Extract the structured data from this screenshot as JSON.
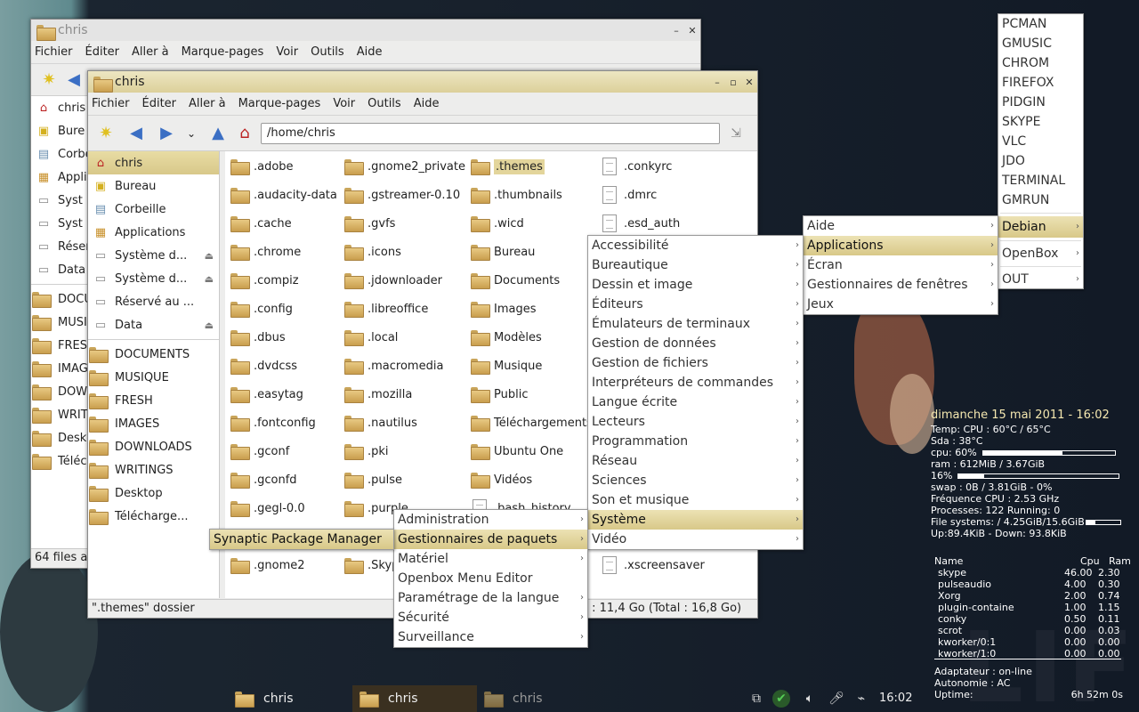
{
  "window_back": {
    "title": "chris",
    "menus": [
      "Fichier",
      "Éditer",
      "Aller à",
      "Marque-pages",
      "Voir",
      "Outils",
      "Aide"
    ],
    "sidebar": [
      "chris",
      "Bureau",
      "Corbeille",
      "Applications",
      "Système d...",
      "Système d...",
      "Réservé au ...",
      "Data",
      "DOCUMENTS",
      "MUSIQUE",
      "FRESH",
      "IMAGES",
      "DOWNLOADS",
      "WRITINGS",
      "Desktop",
      "Télécharge..."
    ],
    "sidebar_visible": [
      "chris",
      "Bure",
      "Corbe",
      "Applic",
      "Syst",
      "Syst",
      "Réser",
      "Data",
      "DOCU",
      "MUSI",
      "FRES",
      "IMAG",
      "DOW",
      "WRIT",
      "Desk",
      "Téléc"
    ],
    "status": "64 files and"
  },
  "window_front": {
    "title": "chris",
    "menus": [
      "Fichier",
      "Éditer",
      "Aller à",
      "Marque-pages",
      "Voir",
      "Outils",
      "Aide"
    ],
    "address": "/home/chris",
    "sidebar_places": [
      "chris",
      "Bureau",
      "Corbeille",
      "Applications",
      "Système d...",
      "Système d...",
      "Réservé au ...",
      "Data"
    ],
    "sidebar_bookmarks": [
      "DOCUMENTS",
      "MUSIQUE",
      "FRESH",
      "IMAGES",
      "DOWNLOADS",
      "WRITINGS",
      "Desktop",
      "Télécharge..."
    ],
    "col1": [
      ".adobe",
      ".audacity-data",
      ".cache",
      ".chrome",
      ".compiz",
      ".config",
      ".dbus",
      ".dvdcss",
      ".easytag",
      ".fontconfig",
      ".gconf",
      ".gconfd",
      ".gegl-0.0",
      "",
      ".gnome2"
    ],
    "col2": [
      ".gnome2_private",
      ".gstreamer-0.10",
      ".gvfs",
      ".icons",
      ".jdownloader",
      ".libreoffice",
      ".local",
      ".macromedia",
      ".mozilla",
      ".nautilus",
      ".pki",
      ".pulse",
      ".purple",
      "",
      ".Skyp"
    ],
    "col3": [
      ".themes",
      ".thumbnails",
      ".wicd",
      "Bureau",
      "Documents",
      "Images",
      "Modèles",
      "Musique",
      "Public",
      "Téléchargements",
      "Ubuntu One",
      "Vidéos",
      ".bash_history"
    ],
    "col4": [
      ".conkyrc",
      ".dmrc",
      ".esd_auth"
    ],
    "col4_last": ".xscreensaver",
    "status_left": "\".themes\" dossier",
    "status_right": "e : 11,4 Go (Total : 16,8 Go)"
  },
  "menu_root": {
    "apps": [
      "PCMAN",
      "GMUSIC",
      "CHROM",
      "FIREFOX",
      "PIDGIN",
      "SKYPE",
      "VLC",
      "JDO",
      "TERMINAL",
      "GMRUN"
    ],
    "debian": "Debian",
    "openbox": "OpenBox",
    "out": "OUT"
  },
  "menu_debian": [
    "Aide",
    "Applications",
    "Écran",
    "Gestionnaires de fenêtres",
    "Jeux"
  ],
  "menu_applications": [
    "Accessibilité",
    "Bureautique",
    "Dessin et image",
    "Éditeurs",
    "Émulateurs de terminaux",
    "Gestion de données",
    "Gestion de fichiers",
    "Interpréteurs de commandes",
    "Langue écrite",
    "Lecteurs",
    "Programmation",
    "Réseau",
    "Sciences",
    "Son et musique",
    "Système",
    "Vidéo"
  ],
  "menu_systeme": [
    "Administration",
    "Gestionnaires de paquets",
    "Matériel",
    "Openbox Menu Editor",
    "Paramétrage de la langue",
    "Sécurité",
    "Surveillance"
  ],
  "menu_paquets": [
    "Synaptic Package Manager"
  ],
  "conky": {
    "date": "dimanche 15 mai 2011 - 16:02",
    "temp": "Temp: CPU : 60°C / 65°C",
    "sda": "Sda : 38°C",
    "cpu": "cpu: 60%",
    "cpu_fill": 0.6,
    "ram": "ram : 612MiB / 3.67GiB",
    "ram_pct": "16%",
    "ram_fill": 0.16,
    "swap": "swap : 0B  / 3.81GiB - 0%",
    "freq": "Fréquence CPU : 2.53 GHz",
    "processes": "Processes: 122  Running: 0",
    "fs": "File systems: / 4.25GiB/15.6GiB",
    "fs_fill": 0.27,
    "net": "Up:89.4KiB  - Down: 93.8KiB",
    "proc_header": [
      "Name",
      "Cpu",
      "Ram"
    ],
    "procs": [
      [
        "skype",
        "46.00",
        "2.30"
      ],
      [
        "pulseaudio",
        "4.00",
        "0.30"
      ],
      [
        "Xorg",
        "2.00",
        "0.74"
      ],
      [
        "plugin-containe",
        "1.00",
        "1.15"
      ],
      [
        "conky",
        "0.50",
        "0.11"
      ],
      [
        "scrot",
        "0.00",
        "0.03"
      ],
      [
        "kworker/0:1",
        "0.00",
        "0.00"
      ],
      [
        "kworker/1:0",
        "0.00",
        "0.00"
      ]
    ],
    "adapter": "Adaptateur : on-line",
    "autonomy": "Autonomie : AC",
    "uptime_label": "Uptime:",
    "uptime": "6h 52m 0s"
  },
  "taskbar": {
    "tasks": [
      "chris",
      "chris",
      "chris"
    ],
    "clock": "16:02"
  },
  "colors": {
    "highlight": "#d8c888",
    "accent": "#e3d59b"
  }
}
